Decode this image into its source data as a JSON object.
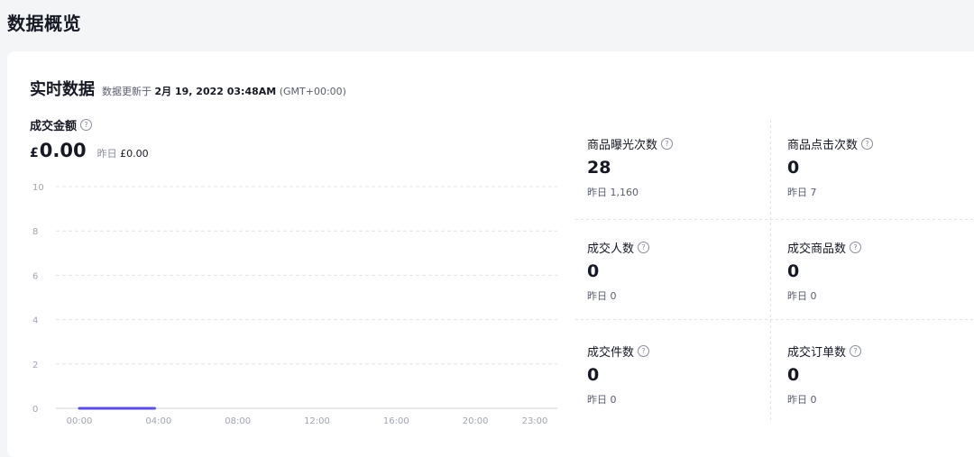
{
  "page": {
    "title": "数据概览"
  },
  "realtime": {
    "title": "实时数据",
    "updated_prefix": "数据更新于",
    "updated_time": "2月 19, 2022 03:48AM",
    "timezone": "(GMT+00:00)"
  },
  "gmv": {
    "label": "成交金额",
    "currency": "£",
    "value": "0.00",
    "yesterday_label": "昨日",
    "yesterday_value": "£0.00"
  },
  "chart_data": {
    "type": "line",
    "title": "",
    "xlabel": "",
    "ylabel": "",
    "x_ticks": [
      "00:00",
      "04:00",
      "08:00",
      "12:00",
      "16:00",
      "20:00",
      "23:00"
    ],
    "y_ticks": [
      "0",
      "2",
      "4",
      "6",
      "8",
      "10"
    ],
    "ylim": [
      0,
      10
    ],
    "xlim_hours": [
      0,
      23
    ],
    "grid": true,
    "series": [
      {
        "color": "#5b4fdb",
        "x_hours": [
          0,
          1,
          2,
          3,
          3.8
        ],
        "values": [
          0,
          0,
          0,
          0,
          0
        ]
      }
    ]
  },
  "metrics": [
    {
      "label": "商品曝光次数",
      "value": "28",
      "yesterday": "昨日 1,160"
    },
    {
      "label": "商品点击次数",
      "value": "0",
      "yesterday": "昨日 7"
    },
    {
      "label": "成交人数",
      "value": "0",
      "yesterday": "昨日 0"
    },
    {
      "label": "成交商品数",
      "value": "0",
      "yesterday": "昨日 0"
    },
    {
      "label": "成交件数",
      "value": "0",
      "yesterday": "昨日 0"
    },
    {
      "label": "成交订单数",
      "value": "0",
      "yesterday": "昨日 0"
    }
  ],
  "icons": {
    "help": "question-circle-icon"
  },
  "colors": {
    "series": "#5b4fdb",
    "grid": "#e3e4e8",
    "axis_text": "#a2a5b0"
  }
}
